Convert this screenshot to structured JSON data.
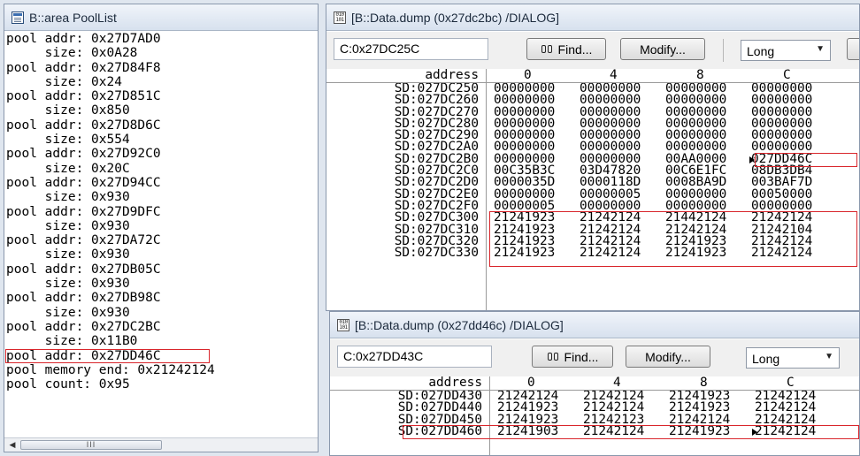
{
  "pool_window": {
    "title": "B::area PoolList",
    "lines": [
      "pool addr: 0x27D7AD0",
      "     size: 0x0A28",
      "pool addr: 0x27D84F8",
      "     size: 0x24",
      "pool addr: 0x27D851C",
      "     size: 0x850",
      "pool addr: 0x27D8D6C",
      "     size: 0x554",
      "pool addr: 0x27D92C0",
      "     size: 0x20C",
      "pool addr: 0x27D94CC",
      "     size: 0x930",
      "pool addr: 0x27D9DFC",
      "     size: 0x930",
      "pool addr: 0x27DA72C",
      "     size: 0x930",
      "pool addr: 0x27DB05C",
      "     size: 0x930",
      "pool addr: 0x27DB98C",
      "     size: 0x930",
      "pool addr: 0x27DC2BC",
      "     size: 0x11B0",
      "pool addr: 0x27DD46C",
      "pool memory end: 0x21242124",
      "pool count: 0x95"
    ],
    "highlight_line": 22,
    "scroll_left_glyph": "◀",
    "scroll_thumb_glyph": "III"
  },
  "dump1": {
    "title": "[B::Data.dump (0x27dc2bc) /DIALOG]",
    "address_value": "C:0x27DC25C",
    "find_label": "Find...",
    "modify_label": "Modify...",
    "format_value": "Long",
    "headers": [
      "address",
      "0",
      "4",
      "8",
      "C"
    ],
    "rows": [
      {
        "addr": "SD:027DC250",
        "vals": [
          "00000000",
          "00000000",
          "00000000",
          "00000000"
        ]
      },
      {
        "addr": "SD:027DC260",
        "vals": [
          "00000000",
          "00000000",
          "00000000",
          "00000000"
        ]
      },
      {
        "addr": "SD:027DC270",
        "vals": [
          "00000000",
          "00000000",
          "00000000",
          "00000000"
        ]
      },
      {
        "addr": "SD:027DC280",
        "vals": [
          "00000000",
          "00000000",
          "00000000",
          "00000000"
        ]
      },
      {
        "addr": "SD:027DC290",
        "vals": [
          "00000000",
          "00000000",
          "00000000",
          "00000000"
        ]
      },
      {
        "addr": "SD:027DC2A0",
        "vals": [
          "00000000",
          "00000000",
          "00000000",
          "00000000"
        ]
      },
      {
        "addr": "SD:027DC2B0",
        "vals": [
          "00000000",
          "00000000",
          "00AA0000",
          "027DD46C"
        ]
      },
      {
        "addr": "SD:027DC2C0",
        "vals": [
          "00C35B3C",
          "03D47820",
          "00C6E1FC",
          "08DB3DB4"
        ]
      },
      {
        "addr": "SD:027DC2D0",
        "vals": [
          "0000035D",
          "0000118D",
          "0008BA9D",
          "003BAF7D"
        ]
      },
      {
        "addr": "SD:027DC2E0",
        "vals": [
          "00000000",
          "00000005",
          "00000000",
          "00050000"
        ]
      },
      {
        "addr": "SD:027DC2F0",
        "vals": [
          "00000005",
          "00000000",
          "00000000",
          "00000000"
        ]
      },
      {
        "addr": "SD:027DC300",
        "vals": [
          "21241923",
          "21242124",
          "21442124",
          "21242124"
        ]
      },
      {
        "addr": "SD:027DC310",
        "vals": [
          "21241923",
          "21242124",
          "21242124",
          "21242104"
        ]
      },
      {
        "addr": "SD:027DC320",
        "vals": [
          "21241923",
          "21242124",
          "21241923",
          "21242124"
        ]
      },
      {
        "addr": "SD:027DC330",
        "vals": [
          "21241923",
          "21242124",
          "21241923",
          "21242124"
        ]
      }
    ]
  },
  "dump2": {
    "title": "[B::Data.dump (0x27dd46c) /DIALOG]",
    "address_value": "C:0x27DD43C",
    "find_label": "Find...",
    "modify_label": "Modify...",
    "format_value": "Long",
    "headers": [
      "address",
      "0",
      "4",
      "8",
      "C"
    ],
    "rows": [
      {
        "addr": "SD:027DD430",
        "vals": [
          "21242124",
          "21242124",
          "21241923",
          "21242124"
        ]
      },
      {
        "addr": "SD:027DD440",
        "vals": [
          "21241923",
          "21242124",
          "21241923",
          "21242124"
        ]
      },
      {
        "addr": "SD:027DD450",
        "vals": [
          "21241923",
          "21242123",
          "21242124",
          "21242124"
        ]
      },
      {
        "addr": "SD:027DD460",
        "vals": [
          "21241903",
          "21242124",
          "21241923",
          "21242124"
        ]
      }
    ]
  },
  "colors": {
    "highlight": "#d9262c"
  }
}
